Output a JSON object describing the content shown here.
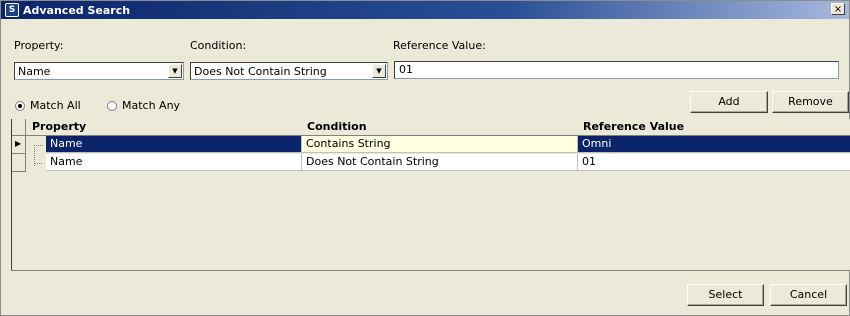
{
  "window": {
    "title": "Advanced Search",
    "close_label": "×"
  },
  "filters": {
    "property_label": "Property:",
    "condition_label": "Condition:",
    "reference_label": "Reference Value:",
    "property_value": "Name",
    "condition_value": "Does Not Contain String",
    "reference_value": "01"
  },
  "match": {
    "all_label": "Match All",
    "any_label": "Match Any",
    "selected": "all"
  },
  "actions": {
    "add_label": "Add",
    "remove_label": "Remove"
  },
  "table": {
    "columns": [
      "Property",
      "Condition",
      "Reference Value"
    ],
    "rows": [
      {
        "property": "Name",
        "condition": "Contains String",
        "reference": "Omni"
      },
      {
        "property": "Name",
        "condition": "Does Not Contain String",
        "reference": "01"
      }
    ]
  },
  "footer": {
    "select_label": "Select",
    "cancel_label": "Cancel"
  }
}
